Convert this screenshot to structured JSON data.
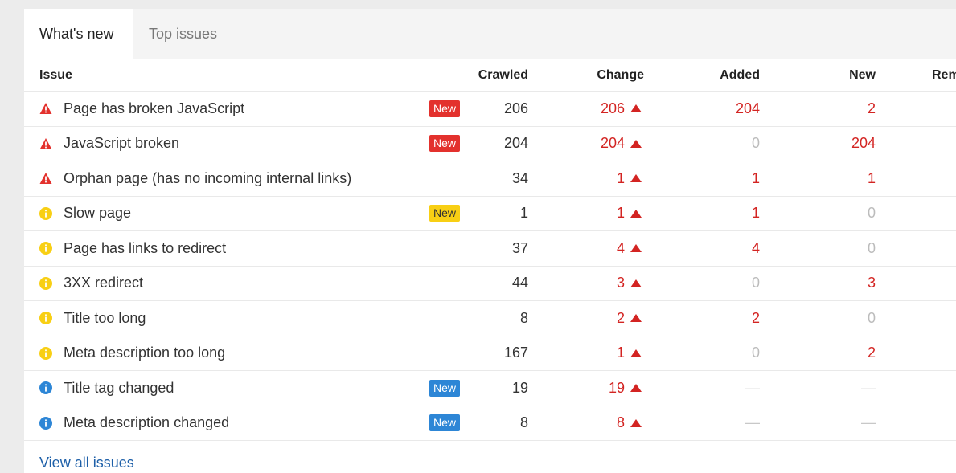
{
  "tabs": {
    "whats_new": "What's new",
    "top_issues": "Top issues"
  },
  "headers": {
    "issue": "Issue",
    "crawled": "Crawled",
    "change": "Change",
    "added": "Added",
    "new": "New",
    "removed": "Rem"
  },
  "rows": [
    {
      "severity": "error",
      "icon": "warning-icon",
      "issue": "Page has broken JavaScript",
      "badge": "New",
      "badge_color": "red",
      "crawled": "206",
      "change": "206",
      "added": "204",
      "new": "2"
    },
    {
      "severity": "error",
      "icon": "warning-icon",
      "issue": "JavaScript broken",
      "badge": "New",
      "badge_color": "red",
      "crawled": "204",
      "change": "204",
      "added": "0",
      "new": "204"
    },
    {
      "severity": "error",
      "icon": "warning-icon",
      "issue": "Orphan page (has no incoming internal links)",
      "badge": "",
      "badge_color": "",
      "crawled": "34",
      "change": "1",
      "added": "1",
      "new": "1"
    },
    {
      "severity": "warning",
      "icon": "info-yellow-icon",
      "issue": "Slow page",
      "badge": "New",
      "badge_color": "yellow",
      "crawled": "1",
      "change": "1",
      "added": "1",
      "new": "0"
    },
    {
      "severity": "warning",
      "icon": "info-yellow-icon",
      "issue": "Page has links to redirect",
      "badge": "",
      "badge_color": "",
      "crawled": "37",
      "change": "4",
      "added": "4",
      "new": "0"
    },
    {
      "severity": "warning",
      "icon": "info-yellow-icon",
      "issue": "3XX redirect",
      "badge": "",
      "badge_color": "",
      "crawled": "44",
      "change": "3",
      "added": "0",
      "new": "3"
    },
    {
      "severity": "warning",
      "icon": "info-yellow-icon",
      "issue": "Title too long",
      "badge": "",
      "badge_color": "",
      "crawled": "8",
      "change": "2",
      "added": "2",
      "new": "0"
    },
    {
      "severity": "warning",
      "icon": "info-yellow-icon",
      "issue": "Meta description too long",
      "badge": "",
      "badge_color": "",
      "crawled": "167",
      "change": "1",
      "added": "0",
      "new": "2"
    },
    {
      "severity": "notice",
      "icon": "info-blue-icon",
      "issue": "Title tag changed",
      "badge": "New",
      "badge_color": "blue",
      "crawled": "19",
      "change": "19",
      "added": "—",
      "new": "—"
    },
    {
      "severity": "notice",
      "icon": "info-blue-icon",
      "issue": "Meta description changed",
      "badge": "New",
      "badge_color": "blue",
      "crawled": "8",
      "change": "8",
      "added": "—",
      "new": "—"
    }
  ],
  "footer": {
    "view_all": "View all issues"
  },
  "colors": {
    "error": "#e3312d",
    "warning": "#f8cf14",
    "notice": "#2d86d6",
    "increase": "#d32422"
  }
}
